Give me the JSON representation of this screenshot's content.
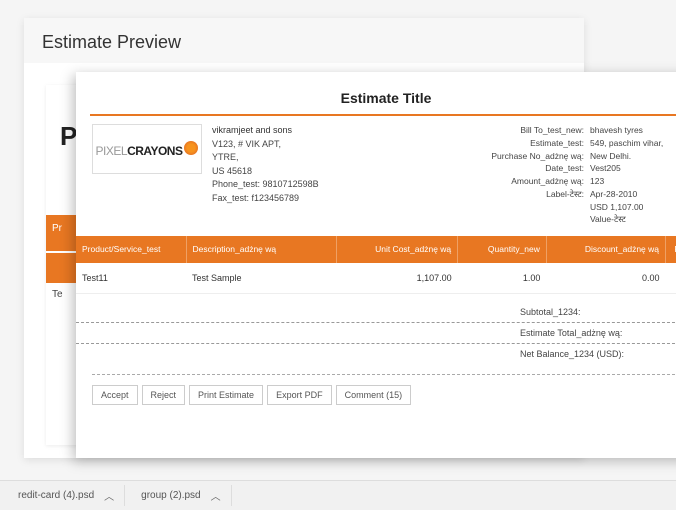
{
  "back": {
    "title": "Estimate Preview",
    "logo_initial": "P",
    "snippet1": "Pr",
    "snippet2": "Te"
  },
  "doc": {
    "title": "Estimate Title",
    "logo": {
      "pixel": "PIXEL",
      "crayons": "CRAYONS"
    },
    "from": [
      "vikramjeet and sons",
      "V123, # VIK APT,",
      "YTRE,",
      "US 45618",
      "Phone_test: 9810712598B",
      "Fax_test: f123456789"
    ],
    "meta_labels": [
      "Bill To_test_new:",
      "",
      "",
      "Estimate_test:",
      "Purchase No_adżnę wą:",
      "Date_test:",
      "Amount_adżnę wą:",
      "Label-टेस्ट:"
    ],
    "meta_values": [
      "bhavesh tyres",
      "549, paschim vihar,",
      "New Delhi.",
      "Vest205",
      "123",
      "Apr-28-2010",
      "USD 1,107.00",
      "Value-टेस्ट"
    ],
    "columns": [
      "Product/Service_test",
      "Description_adżnę wą",
      "Unit Cost_adżnę wą",
      "Quantity_new",
      "Discount_adżnę wą",
      "Pric"
    ],
    "rows": [
      {
        "product": "Test11",
        "desc": "Test Sample",
        "unit": "1,107.00",
        "qty": "1.00",
        "disc": "0.00"
      }
    ],
    "totals": [
      "Subtotal_1234:",
      "Estimate Total_adżnę wą:",
      "Net Balance_1234 (USD):"
    ],
    "actions": {
      "accept": "Accept",
      "reject": "Reject",
      "print": "Print Estimate",
      "export": "Export PDF",
      "comment": "Comment (15)"
    }
  },
  "taskbar": {
    "item1": "redit-card (4).psd",
    "item2": "group (2).psd"
  }
}
